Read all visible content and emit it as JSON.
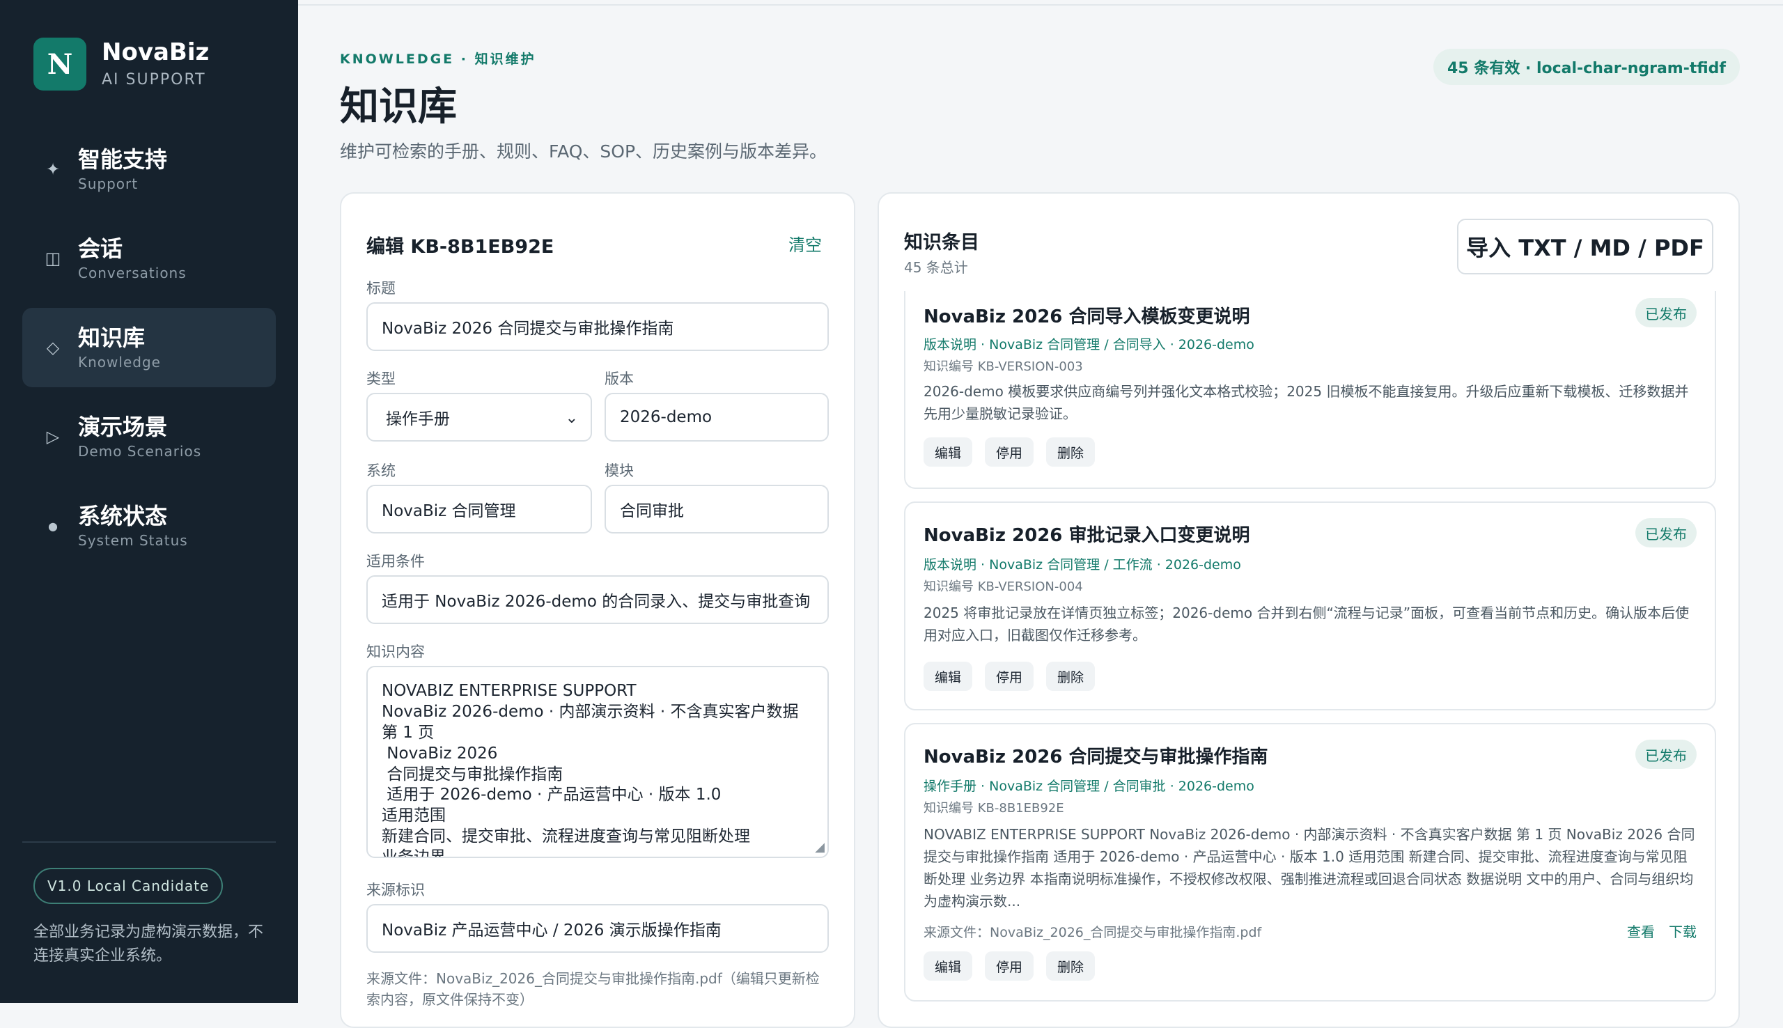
{
  "brand": {
    "logo_letter": "N",
    "name": "NovaBiz",
    "subtitle": "AI SUPPORT"
  },
  "nav": [
    {
      "icon": "sparkle-icon",
      "glyph": "✦",
      "title": "智能支持",
      "subtitle": "Support",
      "active": false
    },
    {
      "icon": "panel-icon",
      "glyph": "◫",
      "title": "会话",
      "subtitle": "Conversations",
      "active": false
    },
    {
      "icon": "diamond-icon",
      "glyph": "◇",
      "title": "知识库",
      "subtitle": "Knowledge",
      "active": true
    },
    {
      "icon": "play-icon",
      "glyph": "▷",
      "title": "演示场景",
      "subtitle": "Demo Scenarios",
      "active": false
    },
    {
      "icon": "dot-icon",
      "glyph": "●",
      "title": "系统状态",
      "subtitle": "System Status",
      "active": false
    }
  ],
  "sidebar_footer": {
    "version": "V1.0 Local Candidate",
    "disclaimer": "全部业务记录为虚构演示数据，不连接真实企业系统。"
  },
  "header": {
    "eyebrow": "KNOWLEDGE · 知识维护",
    "title": "知识库",
    "description": "维护可检索的手册、规则、FAQ、SOP、历史案例与版本差异。",
    "stats_badge": "45 条有效 · local-char-ngram-tfidf"
  },
  "editor": {
    "heading": "编辑 KB-8B1EB92E",
    "clear_label": "清空",
    "title_label": "标题",
    "title_value": "NovaBiz 2026 合同提交与审批操作指南",
    "type_label": "类型",
    "type_value": "操作手册",
    "version_label": "版本",
    "version_value": "2026-demo",
    "system_label": "系统",
    "system_value": "NovaBiz 合同管理",
    "module_label": "模块",
    "module_value": "合同审批",
    "condition_label": "适用条件",
    "condition_value": "适用于 NovaBiz 2026-demo 的合同录入、提交与审批查询",
    "content_label": "知识内容",
    "content_lines": [
      "NOVABIZ ENTERPRISE SUPPORT",
      "NovaBiz 2026-demo · 内部演示资料 · 不含真实客户数据",
      "第 1 页",
      " NovaBiz 2026",
      " 合同提交与审批操作指南",
      " 适用于 2026-demo · 产品运营中心 · 版本 1.0",
      "适用范围",
      "新建合同、提交审批、流程进度查询与常见阻断处理",
      "业务边界"
    ],
    "source_label": "来源标识",
    "source_value": "NovaBiz 产品运营中心 / 2026 演示版操作指南",
    "source_note": "来源文件：NovaBiz_2026_合同提交与审批操作指南.pdf（编辑只更新检索内容，原文件保持不变）"
  },
  "list": {
    "heading": "知识条目",
    "count": "45 条总计",
    "import_label": "导入 TXT / MD / PDF",
    "entries": [
      {
        "title": "NovaBiz 2026 合同导入模板变更说明",
        "status": "已发布",
        "meta": "版本说明 · NovaBiz 合同管理 / 合同导入 · 2026-demo",
        "id": "知识编号 KB-VERSION-003",
        "body": "2026-demo 模板要求供应商编号列并强化文本格式校验；2025 旧模板不能直接复用。升级后应重新下载模板、迁移数据并先用少量脱敏记录验证。",
        "edit": "编辑",
        "disable": "停用",
        "delete": "删除"
      },
      {
        "title": "NovaBiz 2026 审批记录入口变更说明",
        "status": "已发布",
        "meta": "版本说明 · NovaBiz 合同管理 / 工作流 · 2026-demo",
        "id": "知识编号 KB-VERSION-004",
        "body": "2025 将审批记录放在详情页独立标签；2026-demo 合并到右侧“流程与记录”面板，可查看当前节点和历史。确认版本后使用对应入口，旧截图仅作迁移参考。",
        "edit": "编辑",
        "disable": "停用",
        "delete": "删除"
      },
      {
        "title": "NovaBiz 2026 合同提交与审批操作指南",
        "status": "已发布",
        "meta": "操作手册 · NovaBiz 合同管理 / 合同审批 · 2026-demo",
        "id": "知识编号 KB-8B1EB92E",
        "body": "NOVABIZ ENTERPRISE SUPPORT NovaBiz 2026-demo · 内部演示资料 · 不含真实客户数据 第 1 页 NovaBiz 2026 合同提交与审批操作指南 适用于 2026-demo · 产品运营中心 · 版本 1.0 适用范围 新建合同、提交审批、流程进度查询与常见阻断处理 业务边界 本指南说明标准操作，不授权修改权限、强制推进流程或回退合同状态 数据说明 文中的用户、合同与组织均为虚构演示数...",
        "file": "来源文件：NovaBiz_2026_合同提交与审批操作指南.pdf",
        "view": "查看",
        "download": "下载",
        "edit": "编辑",
        "disable": "停用",
        "delete": "删除"
      }
    ]
  },
  "colors": {
    "accent": "#137a6a",
    "sidebar_bg": "#16222d",
    "page_bg": "#f4f6f8"
  }
}
